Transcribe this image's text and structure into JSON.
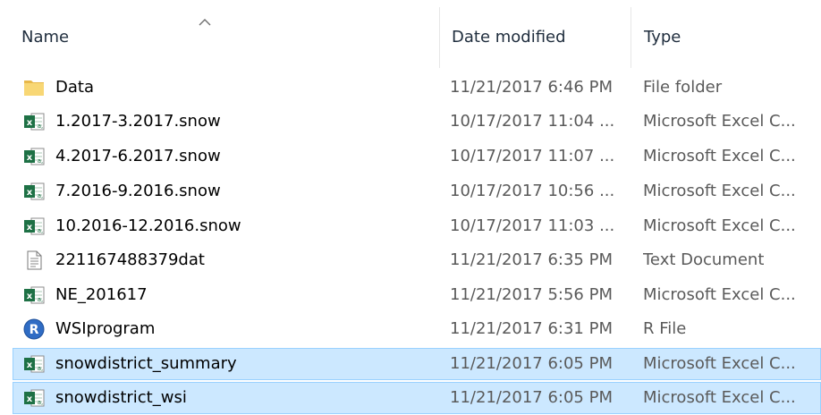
{
  "columns": {
    "name": "Name",
    "date": "Date modified",
    "type": "Type",
    "sort_icon": "chevron-up-icon"
  },
  "colors": {
    "selection_background": "#cce8ff",
    "selection_border": "#99d1ff",
    "secondary_text": "#5a5a5a",
    "excel_green": "#1e7145",
    "folder_yellow": "#f8d775",
    "r_blue": "#2f6cc4"
  },
  "files": [
    {
      "name": "Data",
      "date": "11/21/2017 6:46 PM",
      "type": "File folder",
      "icon": "folder-icon",
      "selected": false
    },
    {
      "name": "1.2017-3.2017.snow",
      "date": "10/17/2017 11:04 ...",
      "type": "Microsoft Excel C...",
      "icon": "excel-csv-icon",
      "selected": false
    },
    {
      "name": "4.2017-6.2017.snow",
      "date": "10/17/2017 11:07 ...",
      "type": "Microsoft Excel C...",
      "icon": "excel-csv-icon",
      "selected": false
    },
    {
      "name": "7.2016-9.2016.snow",
      "date": "10/17/2017 10:56 ...",
      "type": "Microsoft Excel C...",
      "icon": "excel-csv-icon",
      "selected": false
    },
    {
      "name": "10.2016-12.2016.snow",
      "date": "10/17/2017 11:03 ...",
      "type": "Microsoft Excel C...",
      "icon": "excel-csv-icon",
      "selected": false
    },
    {
      "name": "221167488379dat",
      "date": "11/21/2017 6:35 PM",
      "type": "Text Document",
      "icon": "text-document-icon",
      "selected": false
    },
    {
      "name": "NE_201617",
      "date": "11/21/2017 5:56 PM",
      "type": "Microsoft Excel C...",
      "icon": "excel-csv-icon",
      "selected": false
    },
    {
      "name": "WSIprogram",
      "date": "11/21/2017 6:31 PM",
      "type": "R File",
      "icon": "r-file-icon",
      "selected": false
    },
    {
      "name": "snowdistrict_summary",
      "date": "11/21/2017 6:05 PM",
      "type": "Microsoft Excel C...",
      "icon": "excel-csv-icon",
      "selected": true
    },
    {
      "name": "snowdistrict_wsi",
      "date": "11/21/2017 6:05 PM",
      "type": "Microsoft Excel C...",
      "icon": "excel-csv-icon",
      "selected": true
    }
  ]
}
